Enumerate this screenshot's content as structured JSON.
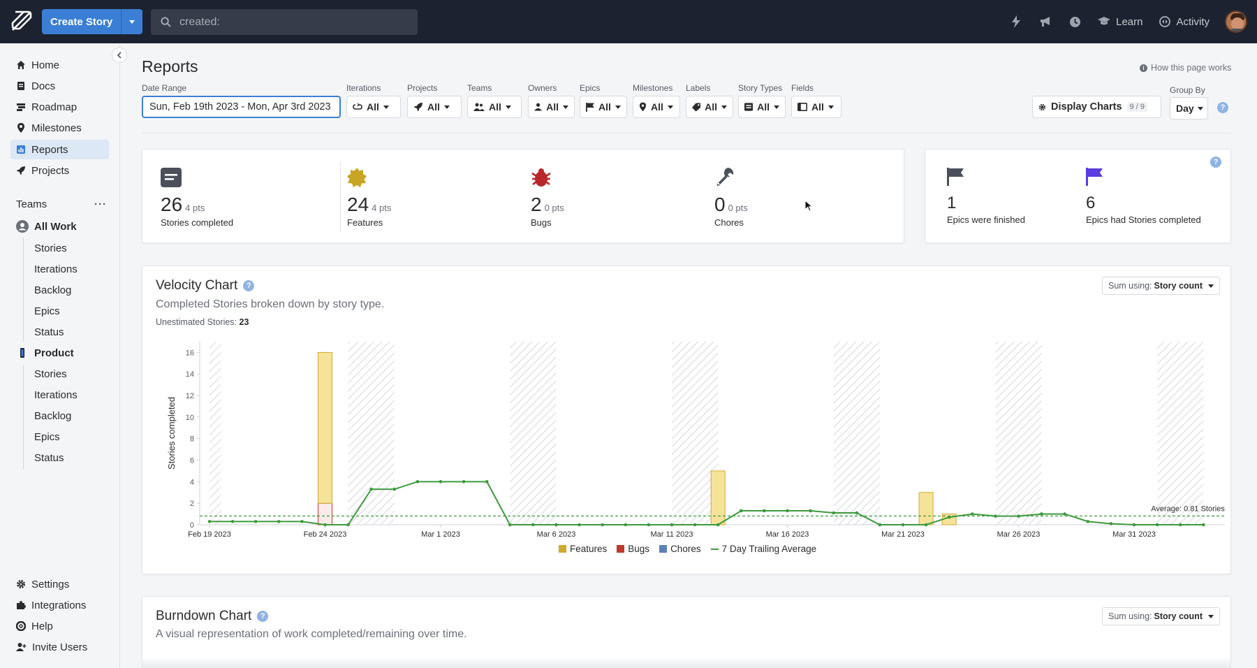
{
  "topbar": {
    "create_label": "Create Story",
    "search_placeholder": "created:",
    "learn_label": "Learn",
    "activity_label": "Activity",
    "icons": [
      "bolt-icon",
      "megaphone-icon",
      "clock-icon"
    ]
  },
  "sidebar": {
    "nav": [
      {
        "label": "Home",
        "icon": "home-icon"
      },
      {
        "label": "Docs",
        "icon": "docs-icon"
      },
      {
        "label": "Roadmap",
        "icon": "roadmap-icon"
      },
      {
        "label": "Milestones",
        "icon": "milestone-icon"
      },
      {
        "label": "Reports",
        "icon": "reports-icon",
        "active": true
      },
      {
        "label": "Projects",
        "icon": "projects-icon"
      }
    ],
    "teams_label": "Teams",
    "teams": [
      {
        "label": "All Work",
        "items": [
          "Stories",
          "Iterations",
          "Backlog",
          "Epics",
          "Status"
        ]
      },
      {
        "label": "Product",
        "items": [
          "Stories",
          "Iterations",
          "Backlog",
          "Epics",
          "Status"
        ]
      }
    ],
    "bottom": [
      {
        "label": "Settings",
        "icon": "gear-icon"
      },
      {
        "label": "Integrations",
        "icon": "puzzle-icon"
      },
      {
        "label": "Help",
        "icon": "help-icon"
      },
      {
        "label": "Invite Users",
        "icon": "invite-user-icon"
      }
    ]
  },
  "page": {
    "title": "Reports",
    "how_link": "How this page works"
  },
  "filters": {
    "date_range_label": "Date Range",
    "date_range_value": "Sun, Feb 19th 2023 - Mon, Apr 3rd 2023",
    "items": [
      {
        "label": "Iterations",
        "value": "All"
      },
      {
        "label": "Projects",
        "value": "All"
      },
      {
        "label": "Teams",
        "value": "All"
      },
      {
        "label": "Owners",
        "value": "All"
      },
      {
        "label": "Epics",
        "value": "All"
      },
      {
        "label": "Milestones",
        "value": "All"
      },
      {
        "label": "Labels",
        "value": "All"
      },
      {
        "label": "Story Types",
        "value": "All"
      },
      {
        "label": "Fields",
        "value": "All"
      }
    ],
    "display_charts_label": "Display Charts",
    "display_charts_count": "9 / 9",
    "group_by_label": "Group By",
    "group_by_value": "Day"
  },
  "summary": {
    "stats": [
      {
        "num": "26",
        "pts": "4 pts",
        "label": "Stories completed"
      },
      {
        "num": "24",
        "pts": "4 pts",
        "label": "Features"
      },
      {
        "num": "2",
        "pts": "0 pts",
        "label": "Bugs"
      },
      {
        "num": "0",
        "pts": "0 pts",
        "label": "Chores"
      }
    ],
    "epics": [
      {
        "num": "1",
        "label": "Epics were finished"
      },
      {
        "num": "6",
        "label": "Epics had Stories completed"
      }
    ]
  },
  "velocity": {
    "title": "Velocity Chart",
    "subtitle": "Completed Stories broken down by story type.",
    "unestimated_label": "Unestimated Stories:",
    "unestimated_value": "23",
    "sum_label": "Sum using:",
    "sum_value": "Story count",
    "average_label": "Average: 0.81 Stories",
    "legend": [
      "Features",
      "Bugs",
      "Chores",
      "7 Day Trailing Average"
    ]
  },
  "burndown": {
    "title": "Burndown Chart",
    "subtitle": "A visual representation of work completed/remaining over time.",
    "sum_label": "Sum using:",
    "sum_value": "Story count"
  },
  "chart_data": {
    "type": "bar",
    "ylabel": "Stories completed",
    "ylim": [
      0,
      17
    ],
    "yticks": [
      0,
      2,
      4,
      6,
      8,
      10,
      12,
      14,
      16
    ],
    "x_tick_labels": [
      "Feb 19 2023",
      "Feb 24 2023",
      "Mar 1 2023",
      "Mar 6 2023",
      "Mar 11 2023",
      "Mar 16 2023",
      "Mar 21 2023",
      "Mar 26 2023",
      "Mar 31 2023"
    ],
    "x_tick_days": [
      0,
      5,
      10,
      15,
      20,
      25,
      30,
      35,
      40
    ],
    "bars": [
      {
        "day": 5,
        "features": 14,
        "bugs": 2,
        "chores": 0
      },
      {
        "day": 22,
        "features": 5,
        "bugs": 0,
        "chores": 0
      },
      {
        "day": 31,
        "features": 3,
        "bugs": 0,
        "chores": 0
      },
      {
        "day": 32,
        "features": 1,
        "bugs": 0,
        "chores": 0
      }
    ],
    "trailing_average": [
      0.3,
      0.3,
      0.3,
      0.3,
      0.3,
      0,
      0,
      3.3,
      3.3,
      4,
      4,
      4,
      4,
      0,
      0,
      0,
      0,
      0,
      0,
      0,
      0,
      0,
      0,
      1.3,
      1.3,
      1.3,
      1.3,
      1.1,
      1.1,
      0,
      0,
      0,
      0.7,
      1,
      0.8,
      0.8,
      1,
      1,
      0.3,
      0.1,
      0,
      0,
      0,
      0
    ],
    "average": 0.81,
    "weekend_days": [
      [
        0,
        0.5
      ],
      [
        6,
        8
      ],
      [
        13,
        15
      ],
      [
        20,
        22
      ],
      [
        27,
        29
      ],
      [
        34,
        36
      ],
      [
        41,
        43
      ]
    ],
    "series_colors": {
      "features": "#f6e39a",
      "features_stroke": "#d2a92d",
      "bugs": "#c0392b",
      "chores": "#5a82b5",
      "average": "#3c9a3c"
    }
  }
}
